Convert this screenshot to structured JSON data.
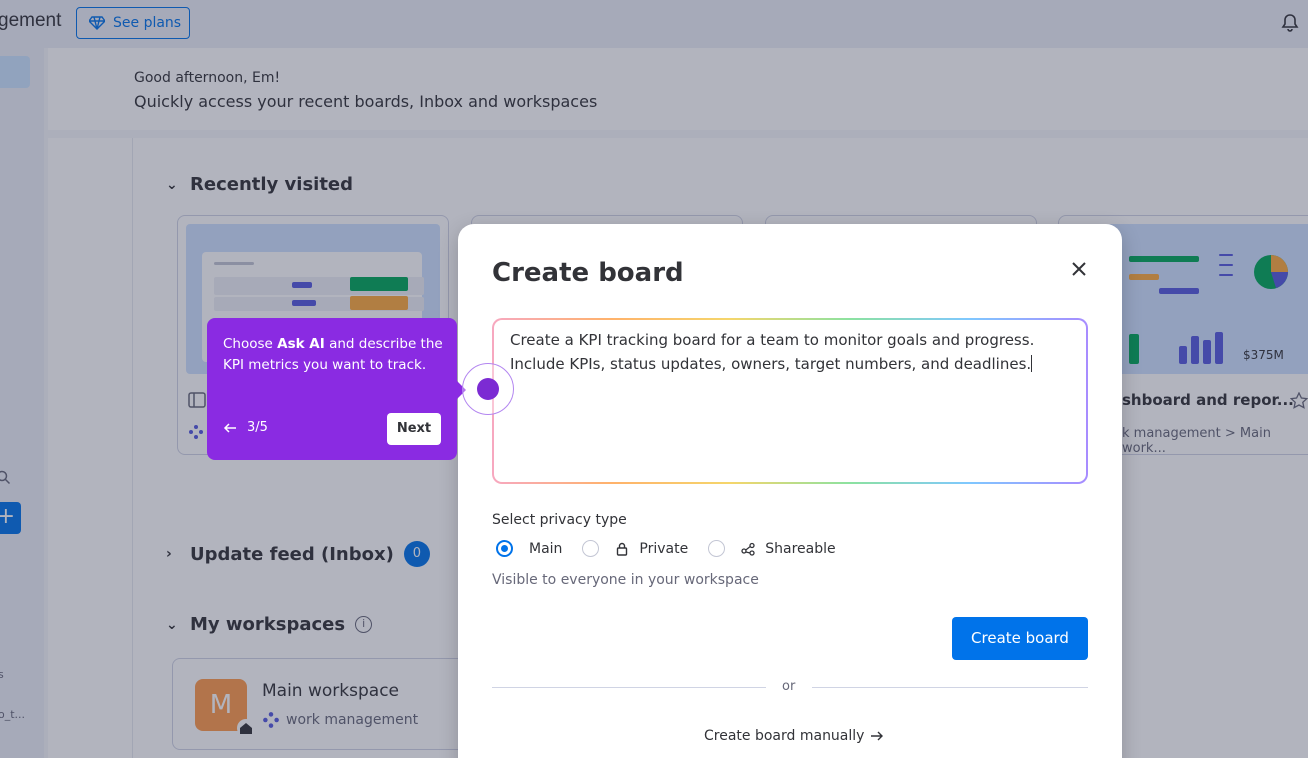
{
  "topbar": {
    "brand_partial": "gement",
    "see_plans": "See plans"
  },
  "sidebar": {
    "add_label": "+",
    "text_partial_1": "s",
    "text_partial_2": "o_t..."
  },
  "home": {
    "greeting": "Good afternoon, Em!",
    "subtitle": "Quickly access your recent boards, Inbox and workspaces"
  },
  "recently_visited": {
    "title": "Recently visited",
    "card4": {
      "title": "shboard and repor...",
      "crumb": "k management > Main work...",
      "price": "$375M"
    }
  },
  "update_feed": {
    "title": "Update feed (Inbox)",
    "count": "0"
  },
  "workspaces": {
    "title": "My workspaces",
    "info": "i",
    "item": {
      "avatar": "M",
      "name": "Main workspace",
      "type": "work management"
    }
  },
  "modal": {
    "title": "Create board",
    "prompt_line1": "Create a KPI tracking board for a team to monitor goals and progress.",
    "prompt_line2": "Include KPIs, status updates, owners, target numbers, and deadlines.",
    "privacy_label": "Select privacy type",
    "options": [
      "Main",
      "Private",
      "Shareable"
    ],
    "selected_option": "Main",
    "visibility_note": "Visible to everyone in your workspace",
    "create_button": "Create board",
    "or": "or",
    "manual_link": "Create board manually"
  },
  "tooltip": {
    "text_before": "Choose ",
    "text_bold": "Ask AI",
    "text_after": " and describe the KPI metrics you want to track.",
    "step": "3/5",
    "next": "Next"
  },
  "colors": {
    "primary": "#0073ea",
    "tooltip": "#8a2be2",
    "workspace_avatar": "#ff9b4c"
  }
}
